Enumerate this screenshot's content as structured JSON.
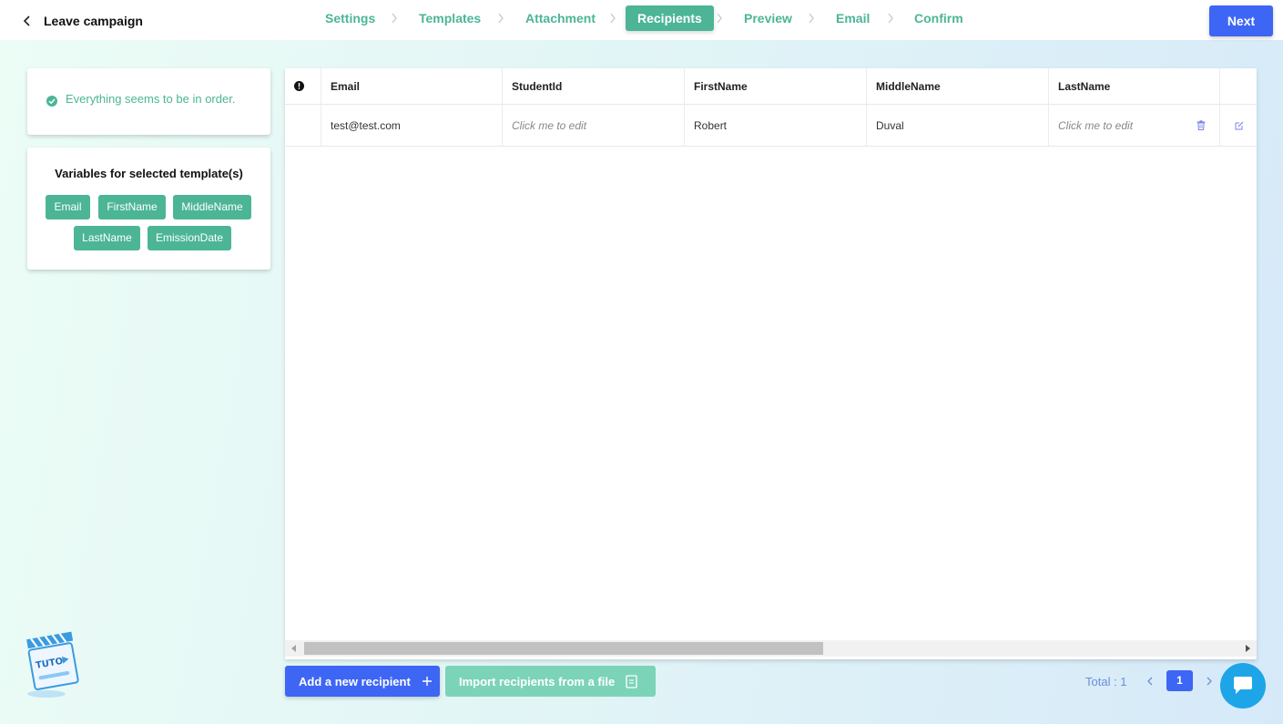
{
  "header": {
    "back_label": "Leave campaign",
    "steps": [
      {
        "label": "Settings",
        "active": false
      },
      {
        "label": "Templates",
        "active": false
      },
      {
        "label": "Attachment",
        "active": false
      },
      {
        "label": "Recipients",
        "active": true
      },
      {
        "label": "Preview",
        "active": false
      },
      {
        "label": "Email",
        "active": false
      },
      {
        "label": "Confirm",
        "active": false
      }
    ],
    "next_label": "Next"
  },
  "status": {
    "message": "Everything seems to be in order."
  },
  "variables": {
    "title": "Variables for selected template(s)",
    "chips": [
      "Email",
      "FirstName",
      "MiddleName",
      "LastName",
      "EmissionDate"
    ]
  },
  "table": {
    "columns": [
      "Email",
      "StudentId",
      "FirstName",
      "MiddleName",
      "LastName"
    ],
    "rows": [
      {
        "email": "test@test.com",
        "student_id": "Click me to edit",
        "first_name": "Robert",
        "middle_name": "Duval",
        "last_name": "Click me to edit"
      }
    ]
  },
  "actions": {
    "add_label": "Add a new recipient",
    "import_label": "Import recipients from a file"
  },
  "pagination": {
    "total_label": "Total : 1",
    "current_page": "1"
  },
  "colors": {
    "accent_green": "#4cb596",
    "primary_blue": "#3e66f4",
    "chat_blue": "#1da5e8"
  },
  "tuto": {
    "label": "TUTO"
  }
}
